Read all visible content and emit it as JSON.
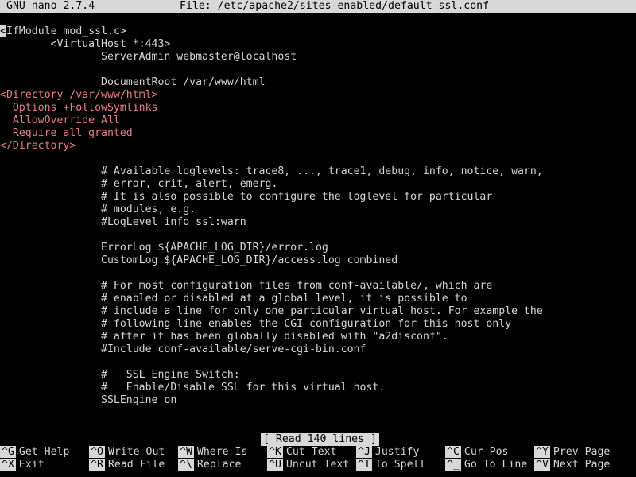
{
  "titlebar": {
    "app": "GNU nano 2.7.4",
    "file": "File: /etc/apache2/sites-enabled/default-ssl.conf"
  },
  "editor": {
    "lines": [
      "<IfModule mod_ssl.c>",
      "        <VirtualHost *:443>",
      "                ServerAdmin webmaster@localhost",
      "",
      "                DocumentRoot /var/www/html",
      "<Directory /var/www/html>",
      "  Options +FollowSymlinks",
      "  AllowOverride All",
      "  Require all granted",
      "</Directory>",
      "",
      "                # Available loglevels: trace8, ..., trace1, debug, info, notice, warn,",
      "                # error, crit, alert, emerg.",
      "                # It is also possible to configure the loglevel for particular",
      "                # modules, e.g.",
      "                #LogLevel info ssl:warn",
      "",
      "                ErrorLog ${APACHE_LOG_DIR}/error.log",
      "                CustomLog ${APACHE_LOG_DIR}/access.log combined",
      "",
      "                # For most configuration files from conf-available/, which are",
      "                # enabled or disabled at a global level, it is possible to",
      "                # include a line for only one particular virtual host. For example the",
      "                # following line enables the CGI configuration for this host only",
      "                # after it has been globally disabled with \"a2disconf\".",
      "                #Include conf-available/serve-cgi-bin.conf",
      "",
      "                #   SSL Engine Switch:",
      "                #   Enable/Disable SSL for this virtual host.",
      "                SSLEngine on"
    ],
    "line_colors": {
      "default": "#d6d6d6",
      "highlight": "#e57f84"
    }
  },
  "status": {
    "message": "[ Read 140 lines ]"
  },
  "shortcuts": [
    {
      "key": "^G",
      "label": "Get Help"
    },
    {
      "key": "^O",
      "label": "Write Out"
    },
    {
      "key": "^W",
      "label": "Where Is"
    },
    {
      "key": "^K",
      "label": "Cut Text"
    },
    {
      "key": "^J",
      "label": "Justify"
    },
    {
      "key": "^C",
      "label": "Cur Pos"
    },
    {
      "key": "^Y",
      "label": "Prev Page"
    },
    {
      "key": "^X",
      "label": "Exit"
    },
    {
      "key": "^R",
      "label": "Read File"
    },
    {
      "key": "^\\",
      "label": "Replace"
    },
    {
      "key": "^U",
      "label": "Uncut Text"
    },
    {
      "key": "^T",
      "label": "To Spell"
    },
    {
      "key": "^_",
      "label": "Go To Line"
    },
    {
      "key": "^V",
      "label": "Next Page"
    }
  ]
}
